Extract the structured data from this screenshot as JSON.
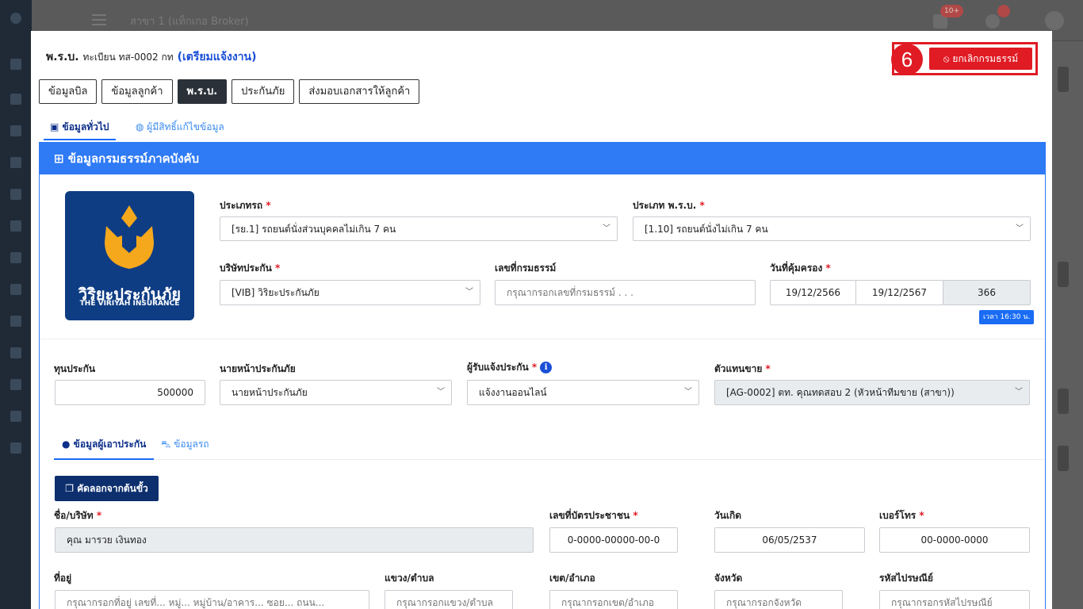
{
  "background": {
    "branch": "สาขา 1 (แท็กเกอ Broker)",
    "badge_count": "10+"
  },
  "header": {
    "title_prefix": "พ.ร.บ.",
    "title_registration": "ทะเบียน ทส-0002 กท",
    "status": "(เตรียมแจ้งงาน)",
    "step_number": "6",
    "cancel_label": "⦸ ยกเลิกกรมธรรม์"
  },
  "tabs": [
    "ข้อมูลบิล",
    "ข้อมูลลูกค้า",
    "พ.ร.บ.",
    "ประกันภัย",
    "ส่งมอบเอกสารให้ลูกค้า"
  ],
  "subtabs": {
    "general": "ข้อมูลทั่วไป",
    "editors": "ผู้มีสิทธิ์แก้ไขข้อมูล"
  },
  "card": {
    "title": "ข้อมูลกรมธรรม์ภาคบังคับ",
    "logo_th": "วิริยะประกันภัย",
    "logo_en": "THE VIRIYAH INSURANCE",
    "vehicle_type": {
      "label": "ประเภทรถ",
      "value": "[รย.1] รถยนต์นั่งส่วนบุคคลไม่เกิน 7 คน"
    },
    "prb_type": {
      "label": "ประเภท พ.ร.บ.",
      "value": "[1.10] รถยนต์นั่งไม่เกิน 7 คน"
    },
    "insurer": {
      "label": "บริษัทประกัน",
      "value": "[VIB] วิริยะประกันภัย"
    },
    "policy_no": {
      "label": "เลขที่กรมธรรม์",
      "placeholder": "กรุณากรอกเลขที่กรมธรรม์ . . ."
    },
    "coverage": {
      "label": "วันที่คุ้มครอง",
      "start": "19/12/2566",
      "end": "19/12/2567",
      "days": "366",
      "time": "เวลา 16:30 น."
    },
    "sum_insured": {
      "label": "ทุนประกัน",
      "value": "500000"
    },
    "broker": {
      "label": "นายหน้าประกันภัย",
      "value": "นายหน้าประกันภัย"
    },
    "notifier": {
      "label": "ผู้รับแจ้งประกัน",
      "value": "แจ้งงานออนไลน์"
    },
    "agent": {
      "label": "ตัวแทนขาย",
      "value": "[AG-0002] ตท. คุณทดสอบ 2 (หัวหน้าทีมขาย (สาขา))"
    }
  },
  "insured": {
    "tab_person": "ข้อมูลผู้เอาประกัน",
    "tab_car": "ข้อมูลรถ",
    "copy_button": "คัดลอกจากต้นขั้ว",
    "name": {
      "label": "ชื่อ/บริษัท",
      "value": "คุณ มารวย เงินทอง"
    },
    "id_card": {
      "label": "เลขที่บัตรประชาชน",
      "value": "0-0000-00000-00-0"
    },
    "birthdate": {
      "label": "วันเกิด",
      "value": "06/05/2537"
    },
    "phone": {
      "label": "เบอร์โทร",
      "value": "00-0000-0000"
    },
    "address": {
      "label": "ที่อยู่",
      "placeholder": "กรุณากรอกที่อยู่ เลขที่... หมู่... หมู่บ้าน/อาคาร... ซอย... ถนน..."
    },
    "subdistrict": {
      "label": "แขวง/ตำบล",
      "placeholder": "กรุณากรอกแขวง/ตำบล"
    },
    "district": {
      "label": "เขต/อำเภอ",
      "placeholder": "กรุณากรอกเขต/อำเภอ"
    },
    "province": {
      "label": "จังหวัด",
      "placeholder": "กรุณากรอกจังหวัด"
    },
    "postal": {
      "label": "รหัสไปรษณีย์",
      "placeholder": "กรุณากรอกรหัสไปรษณีย์"
    }
  },
  "colors": {
    "primary": "#2f7af5",
    "danger": "#e01b24",
    "dark": "#2b3138",
    "navy": "#0d2f6e",
    "logo_bg": "#0f3d84",
    "logo_gold": "#f5a81c"
  }
}
